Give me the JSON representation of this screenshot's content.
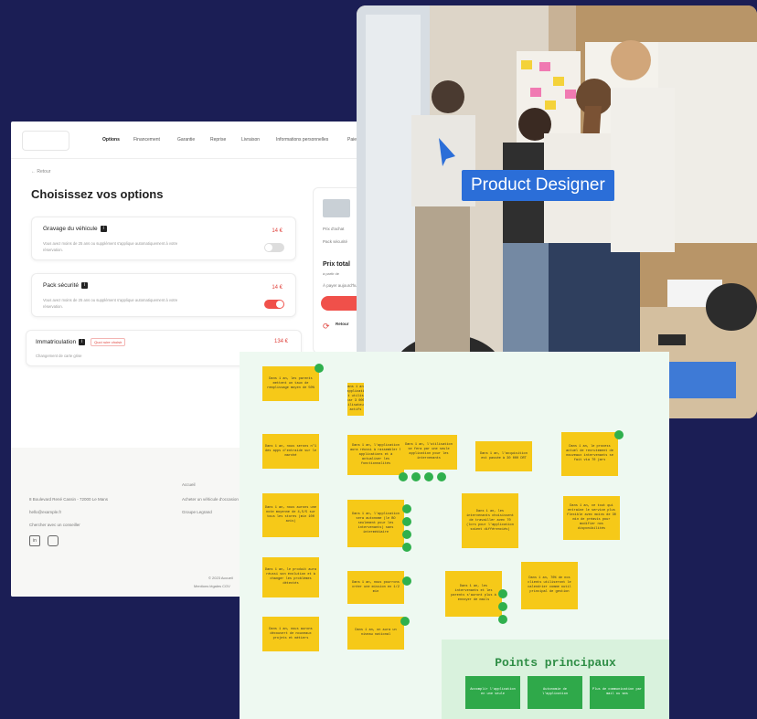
{
  "web_page": {
    "nav_tabs": [
      "Options",
      "Financement",
      "Garantie",
      "Reprise",
      "Livraison",
      "Informations personnelles",
      "Paie"
    ],
    "back_label": "Retour",
    "title": "Choisissez vos options",
    "options": [
      {
        "title": "Gravage du véhicule",
        "price": "14 €",
        "description": "Vous avez moins de 25 ans ou supplément s'applique automatiquement à votre réservation.",
        "toggle": "off"
      },
      {
        "title": "Pack sécurité",
        "price": "14 €",
        "description": "Vous avez moins de 25 ans ou supplément s'applique automatiquement à votre réservation.",
        "toggle": "on"
      },
      {
        "title": "Immatriculation",
        "price": "134 €",
        "tag": "Quoi ruire choisir",
        "description": "Changement de carte grise"
      }
    ],
    "side": {
      "label1": "Prix d'achat",
      "label2": "Pack sécurité",
      "total_label": "Prix total",
      "total_sub": "à partir de",
      "note": "À payer aujourd'hui",
      "return_label": "Retour"
    },
    "footer": {
      "address": "8 Boulevard René Cassin - 72000 Le Mans",
      "email": "hello@example.fr",
      "advisor": "Chercher avec un conseiller",
      "col2_title": "Accueil",
      "col2_items": [
        "Acheter un véhicule d'occasion",
        "Groupe Legrand"
      ],
      "copyright": "© 2023 Accueil",
      "legal": "Mentions légales CGV"
    }
  },
  "photo": {
    "badge": "Product Designer",
    "colors": {
      "badge": "#2b6ed8"
    }
  },
  "board": {
    "stickies": [
      "Dans 1 an, les parents mettent un taux de remplissage moyen de 50%",
      "Dans 1 an, l'application est utilisée par 3 000 utilisateurs actifs",
      "Dans 1 an, nous serons n°1 des apps d'entraide sur le marché",
      "Dans 1 an, l'application aura réussi à rassembler 5 applications et à actualiser les fonctionnalités",
      "Dans 1 an, l'utilisation se fera par une seule application pour les intervenants",
      "Dans 1 an, l'acquisition est passée à 30 000 DRT",
      "Dans 1 an, le process actuel de recrutement de nouveaux intervenants se fait via 70 jars",
      "Dans 1 an, nous aurons une note moyenne de 4,5/5 sur tous les stores (min 100 avis)",
      "Dans 1 an, l'application sera autonome (le BO seulement pour les intervenants) sans intermédiaire",
      "Dans 1 an, les intervenants choisissent de travailler avec 70 (lors pour l'application soient différenciés)",
      "Dans 1 an, ce tout qui entraîne le service plus flexible avec moins de 30 min de préavis pour modifier nos disponibilités",
      "Dans 1 an, le produit aura réussi son évolution et à changer les problèmes détectés",
      "Dans 1 an, nous pourrons créer une mission en 1/2 min",
      "Dans 1 an, les intervenants et les parents s'auront plus à envoyer de mails",
      "Dans 1 an, 70% de nos clients utiliseront le calendrier comme outil principal de gestion",
      "Dans 1 an, nous aurons découvert de nouveaux projets et métiers",
      "Dans 1 an, on aura un niveau national"
    ],
    "key_title": "Points principaux",
    "key_items": [
      "Accomplir l'application en une seule",
      "Autonomie de l'application",
      "Plus de communication par mail ou sms"
    ],
    "colors": {
      "sticky": "#f6c918",
      "dot": "#2fb04d",
      "panel": "#d9f2dd"
    }
  }
}
